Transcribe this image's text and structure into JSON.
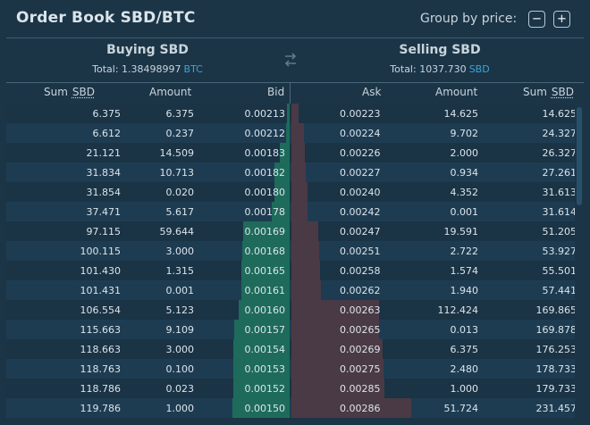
{
  "header": {
    "title": "Order Book SBD/BTC",
    "group_label": "Group by price:",
    "minus_label": "−",
    "plus_label": "+"
  },
  "buy_side": {
    "title": "Buying SBD",
    "total_label": "Total: 1.38498997",
    "total_unit": "BTC"
  },
  "sell_side": {
    "title": "Selling SBD",
    "total_label": "Total: 1037.730",
    "total_unit": "SBD"
  },
  "columns": {
    "sum": "Sum",
    "sum_unit": "SBD",
    "amount": "Amount",
    "bid": "Bid",
    "ask": "Ask",
    "amount_sell": "Amount",
    "sum_sell": "Sum",
    "sum_sell_unit": "SBD"
  },
  "rows": [
    {
      "b_sum": "6.375",
      "b_amt": "6.375",
      "bid": "0.00213",
      "ask": "0.00223",
      "a_amt": "14.625",
      "a_sum": "14.625"
    },
    {
      "b_sum": "6.612",
      "b_amt": "0.237",
      "bid": "0.00212",
      "ask": "0.00224",
      "a_amt": "9.702",
      "a_sum": "24.327"
    },
    {
      "b_sum": "21.121",
      "b_amt": "14.509",
      "bid": "0.00183",
      "ask": "0.00226",
      "a_amt": "2.000",
      "a_sum": "26.327"
    },
    {
      "b_sum": "31.834",
      "b_amt": "10.713",
      "bid": "0.00182",
      "ask": "0.00227",
      "a_amt": "0.934",
      "a_sum": "27.261"
    },
    {
      "b_sum": "31.854",
      "b_amt": "0.020",
      "bid": "0.00180",
      "ask": "0.00240",
      "a_amt": "4.352",
      "a_sum": "31.613"
    },
    {
      "b_sum": "37.471",
      "b_amt": "5.617",
      "bid": "0.00178",
      "ask": "0.00242",
      "a_amt": "0.001",
      "a_sum": "31.614"
    },
    {
      "b_sum": "97.115",
      "b_amt": "59.644",
      "bid": "0.00169",
      "ask": "0.00247",
      "a_amt": "19.591",
      "a_sum": "51.205"
    },
    {
      "b_sum": "100.115",
      "b_amt": "3.000",
      "bid": "0.00168",
      "ask": "0.00251",
      "a_amt": "2.722",
      "a_sum": "53.927"
    },
    {
      "b_sum": "101.430",
      "b_amt": "1.315",
      "bid": "0.00165",
      "ask": "0.00258",
      "a_amt": "1.574",
      "a_sum": "55.501"
    },
    {
      "b_sum": "101.431",
      "b_amt": "0.001",
      "bid": "0.00161",
      "ask": "0.00262",
      "a_amt": "1.940",
      "a_sum": "57.441"
    },
    {
      "b_sum": "106.554",
      "b_amt": "5.123",
      "bid": "0.00160",
      "ask": "0.00263",
      "a_amt": "112.424",
      "a_sum": "169.865"
    },
    {
      "b_sum": "115.663",
      "b_amt": "9.109",
      "bid": "0.00157",
      "ask": "0.00265",
      "a_amt": "0.013",
      "a_sum": "169.878"
    },
    {
      "b_sum": "118.663",
      "b_amt": "3.000",
      "bid": "0.00154",
      "ask": "0.00269",
      "a_amt": "6.375",
      "a_sum": "176.253"
    },
    {
      "b_sum": "118.763",
      "b_amt": "0.100",
      "bid": "0.00153",
      "ask": "0.00275",
      "a_amt": "2.480",
      "a_sum": "178.733"
    },
    {
      "b_sum": "118.786",
      "b_amt": "0.023",
      "bid": "0.00152",
      "ask": "0.00285",
      "a_amt": "1.000",
      "a_sum": "179.733"
    },
    {
      "b_sum": "119.786",
      "b_amt": "1.000",
      "bid": "0.00150",
      "ask": "0.00286",
      "a_amt": "51.724",
      "a_sum": "231.457"
    }
  ],
  "colors": {
    "background": "#1b3547",
    "bid_depth": "#1e6b5b",
    "ask_depth": "#4a3a45",
    "accent": "#3ea3d8"
  }
}
